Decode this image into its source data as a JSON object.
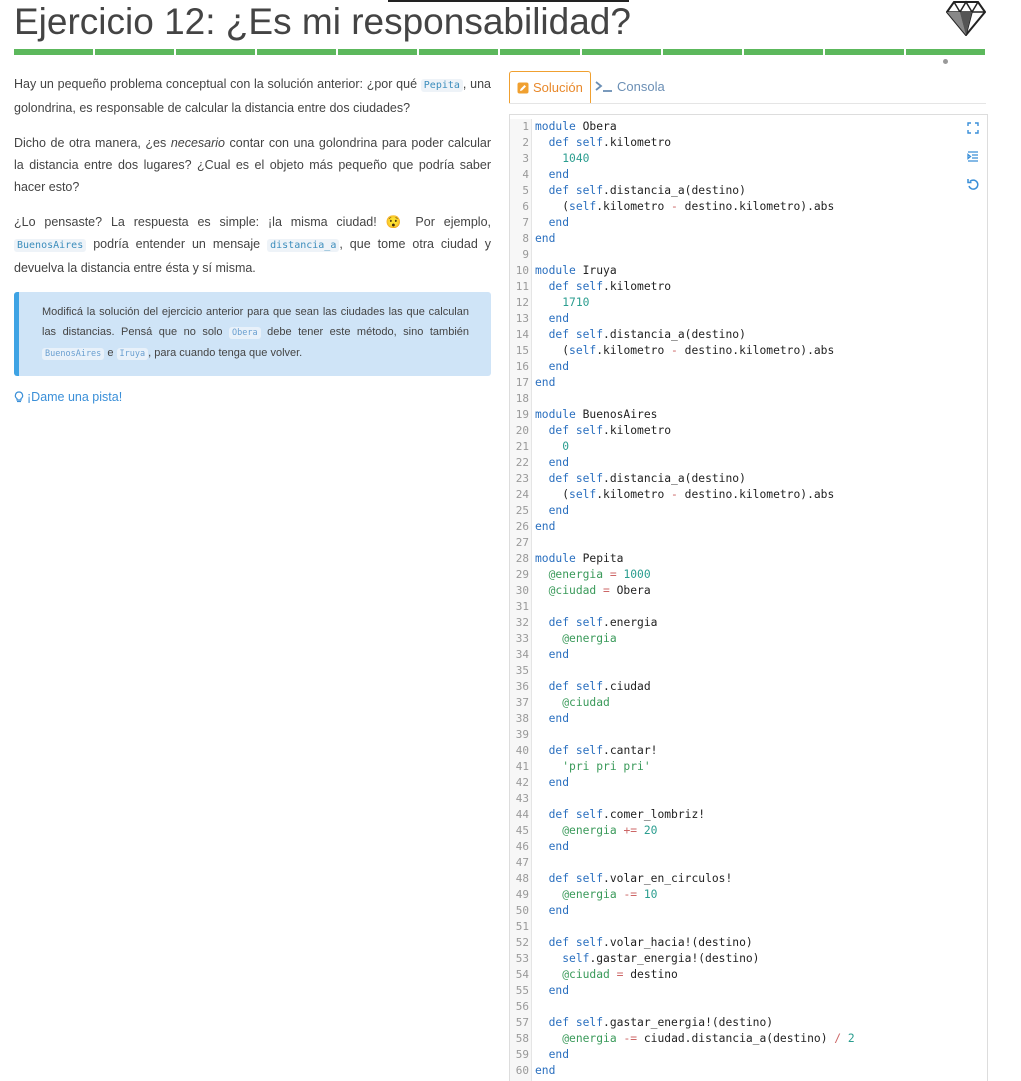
{
  "header": {
    "title": "Ejercicio 12: ¿Es mi responsabilidad?",
    "progress_segments": 12
  },
  "statement": {
    "p1_a": "Hay un pequeño problema conceptual con la solución anterior: ¿por qué ",
    "p1_code": "Pepita",
    "p1_b": ", una golondrina, es responsable de calcular la distancia entre dos ciudades?",
    "p2_a": "Dicho de otra manera, ¿es ",
    "p2_em": "necesario",
    "p2_b": " contar con una golondrina para poder calcular la distancia entre dos lugares? ¿Cual es el objeto más pequeño que podría saber hacer esto?",
    "p3_a": "¿Lo pensaste? La respuesta es simple: ¡la misma ciudad! ",
    "p3_emoji": "😯",
    "p3_b": " Por ejemplo, ",
    "p3_code1": "BuenosAires",
    "p3_c": " podría entender un mensaje ",
    "p3_code2": "distancia_a",
    "p3_d": ", que tome otra ciudad y devuelva la distancia entre ésta y sí misma."
  },
  "callout": {
    "a": "Modificá la solución del ejercicio anterior para que sean las ciudades las que calculan las distancias. Pensá que no solo ",
    "code1": "Obera",
    "b": " debe tener este método, sino también ",
    "code2": "BuenosAires",
    "c": " e ",
    "code3": "Iruya",
    "d": ", para cuando tenga que volver."
  },
  "hint": {
    "label": "¡Dame una pista!"
  },
  "tabs": {
    "solution": "Solución",
    "console": "Consola"
  },
  "editor": {
    "lines": [
      "module Obera",
      "  def self.kilometro",
      "    1040",
      "  end",
      "  def self.distancia_a(destino)",
      "    (self.kilometro - destino.kilometro).abs",
      "  end",
      "end",
      "",
      "module Iruya",
      "  def self.kilometro",
      "    1710",
      "  end",
      "  def self.distancia_a(destino)",
      "    (self.kilometro - destino.kilometro).abs",
      "  end",
      "end",
      "",
      "module BuenosAires",
      "  def self.kilometro",
      "    0",
      "  end",
      "  def self.distancia_a(destino)",
      "    (self.kilometro - destino.kilometro).abs",
      "  end",
      "end",
      "",
      "module Pepita",
      "  @energia = 1000",
      "  @ciudad = Obera",
      "",
      "  def self.energia",
      "    @energia",
      "  end",
      "",
      "  def self.ciudad",
      "    @ciudad",
      "  end",
      "",
      "  def self.cantar!",
      "    'pri pri pri'",
      "  end",
      "",
      "  def self.comer_lombriz!",
      "    @energia += 20",
      "  end",
      "",
      "  def self.volar_en_circulos!",
      "    @energia -= 10",
      "  end",
      "",
      "  def self.volar_hacia!(destino)",
      "    self.gastar_energia!(destino)",
      "    @ciudad = destino",
      "  end",
      "",
      "  def self.gastar_energia!(destino)",
      "    @energia -= ciudad.distancia_a(destino) / 2",
      "  end",
      "end"
    ]
  }
}
